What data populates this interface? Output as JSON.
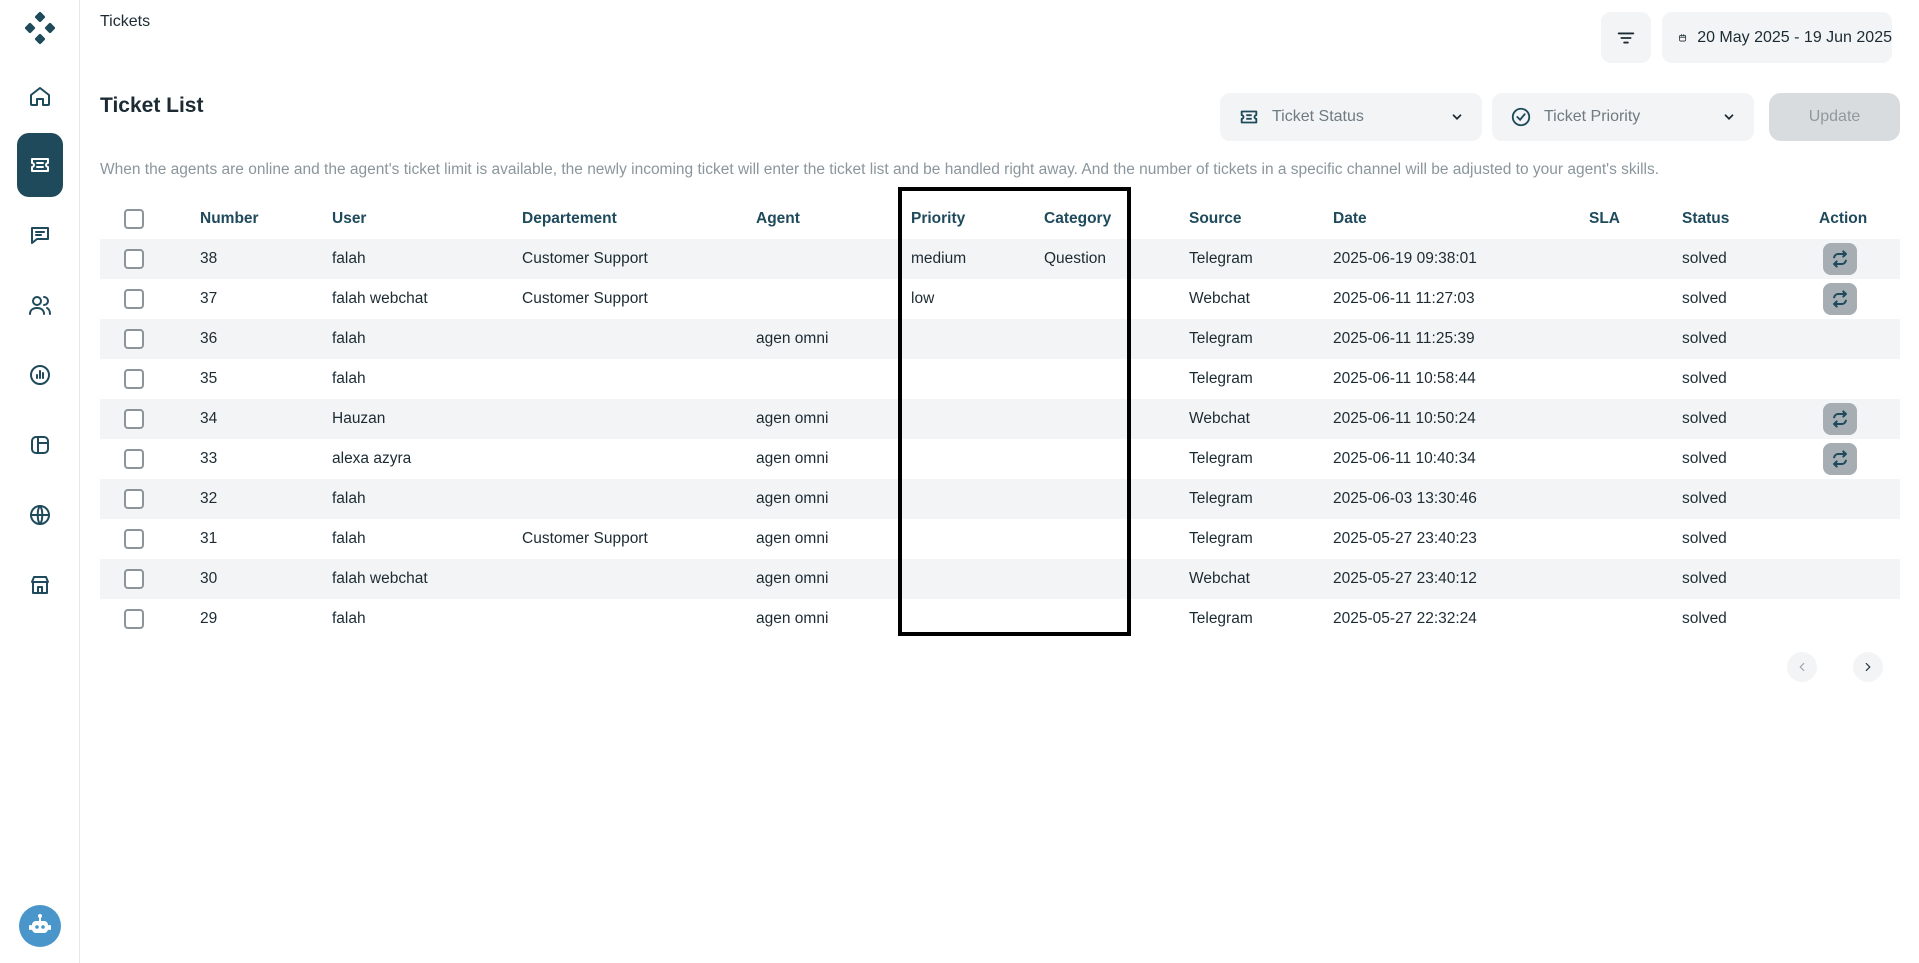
{
  "header": {
    "title": "Tickets",
    "date_range": "20 May 2025 - 19 Jun 2025"
  },
  "sidebar": {
    "items": [
      {
        "icon": "home-icon"
      },
      {
        "icon": "ticket-icon",
        "active": true
      },
      {
        "icon": "chat-icon"
      },
      {
        "icon": "users-icon"
      },
      {
        "icon": "report-icon"
      },
      {
        "icon": "template-icon"
      },
      {
        "icon": "globe-icon"
      },
      {
        "icon": "store-icon"
      }
    ]
  },
  "main": {
    "section_title": "Ticket List",
    "status_filter_placeholder": "Ticket Status",
    "priority_filter_placeholder": "Ticket Priority",
    "update_label": "Update",
    "description": "When the agents are online and the agent's ticket limit is available, the newly incoming ticket will enter the ticket list and be handled right away. And the number of tickets in a specific channel will be adjusted to your agent's skills."
  },
  "table": {
    "columns": {
      "number": "Number",
      "user": "User",
      "department": "Departement",
      "agent": "Agent",
      "priority": "Priority",
      "category": "Category",
      "source": "Source",
      "date": "Date",
      "sla": "SLA",
      "status": "Status",
      "action": "Action"
    },
    "rows": [
      {
        "number": "38",
        "user": "falah",
        "department": "Customer Support",
        "agent": "",
        "priority": "medium",
        "category": "Question",
        "source": "Telegram",
        "date": "2025-06-19 09:38:01",
        "sla": "",
        "status": "solved",
        "has_action": true
      },
      {
        "number": "37",
        "user": "falah webchat",
        "department": "Customer Support",
        "agent": "",
        "priority": "low",
        "category": "",
        "source": "Webchat",
        "date": "2025-06-11 11:27:03",
        "sla": "",
        "status": "solved",
        "has_action": true
      },
      {
        "number": "36",
        "user": "falah",
        "department": "",
        "agent": "agen omni",
        "priority": "",
        "category": "",
        "source": "Telegram",
        "date": "2025-06-11 11:25:39",
        "sla": "",
        "status": "solved",
        "has_action": false
      },
      {
        "number": "35",
        "user": "falah",
        "department": "",
        "agent": "",
        "priority": "",
        "category": "",
        "source": "Telegram",
        "date": "2025-06-11 10:58:44",
        "sla": "",
        "status": "solved",
        "has_action": false
      },
      {
        "number": "34",
        "user": "Hauzan",
        "department": "",
        "agent": "agen omni",
        "priority": "",
        "category": "",
        "source": "Webchat",
        "date": "2025-06-11 10:50:24",
        "sla": "",
        "status": "solved",
        "has_action": true
      },
      {
        "number": "33",
        "user": "alexa azyra",
        "department": "",
        "agent": "agen omni",
        "priority": "",
        "category": "",
        "source": "Telegram",
        "date": "2025-06-11 10:40:34",
        "sla": "",
        "status": "solved",
        "has_action": true
      },
      {
        "number": "32",
        "user": "falah",
        "department": "",
        "agent": "agen omni",
        "priority": "",
        "category": "",
        "source": "Telegram",
        "date": "2025-06-03 13:30:46",
        "sla": "",
        "status": "solved",
        "has_action": false
      },
      {
        "number": "31",
        "user": "falah",
        "department": "Customer Support",
        "agent": "agen omni",
        "priority": "",
        "category": "",
        "source": "Telegram",
        "date": "2025-05-27 23:40:23",
        "sla": "",
        "status": "solved",
        "has_action": false
      },
      {
        "number": "30",
        "user": "falah webchat",
        "department": "",
        "agent": "agen omni",
        "priority": "",
        "category": "",
        "source": "Webchat",
        "date": "2025-05-27 23:40:12",
        "sla": "",
        "status": "solved",
        "has_action": false
      },
      {
        "number": "29",
        "user": "falah",
        "department": "",
        "agent": "agen omni",
        "priority": "",
        "category": "",
        "source": "Telegram",
        "date": "2025-05-27 22:32:24",
        "sla": "",
        "status": "solved",
        "has_action": false
      }
    ]
  },
  "colors": {
    "brand": "#1e4a5c",
    "stripe": "#f3f4f5",
    "control_bg": "#f2f4f5",
    "highlight_border": "#000000"
  }
}
